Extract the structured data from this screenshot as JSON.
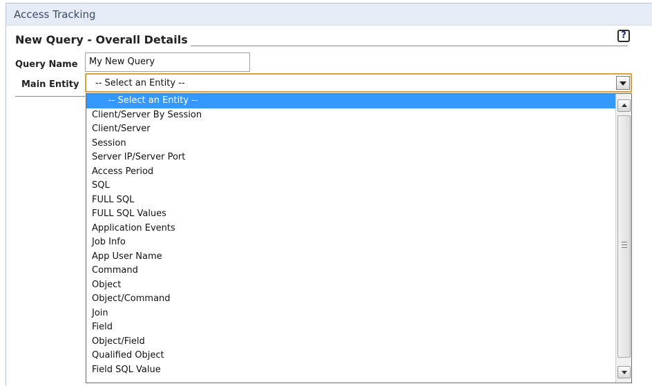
{
  "panel": {
    "title": "Access Tracking",
    "section_title": "New Query - Overall Details",
    "help_label": "?"
  },
  "form": {
    "query_name_label": "Query Name",
    "query_name_value": "My New Query",
    "main_entity_label": "Main Entity",
    "main_entity_value": "-- Select an Entity --"
  },
  "dropdown": {
    "options": [
      "-- Select an Entity --",
      "Client/Server By Session",
      "Client/Server",
      "Session",
      "Server IP/Server Port",
      "Access Period",
      "SQL",
      "FULL SQL",
      "FULL SQL Values",
      "Application Events",
      "Job Info",
      "App User Name",
      "Command",
      "Object",
      "Object/Command",
      "Join",
      "Field",
      "Object/Field",
      "Qualified Object",
      "Field SQL Value"
    ],
    "selected_index": 0
  },
  "colors": {
    "titlebar_bg": "#e6ecf5",
    "selection_bg": "#3399ff",
    "focus_border": "#d8a13a"
  }
}
